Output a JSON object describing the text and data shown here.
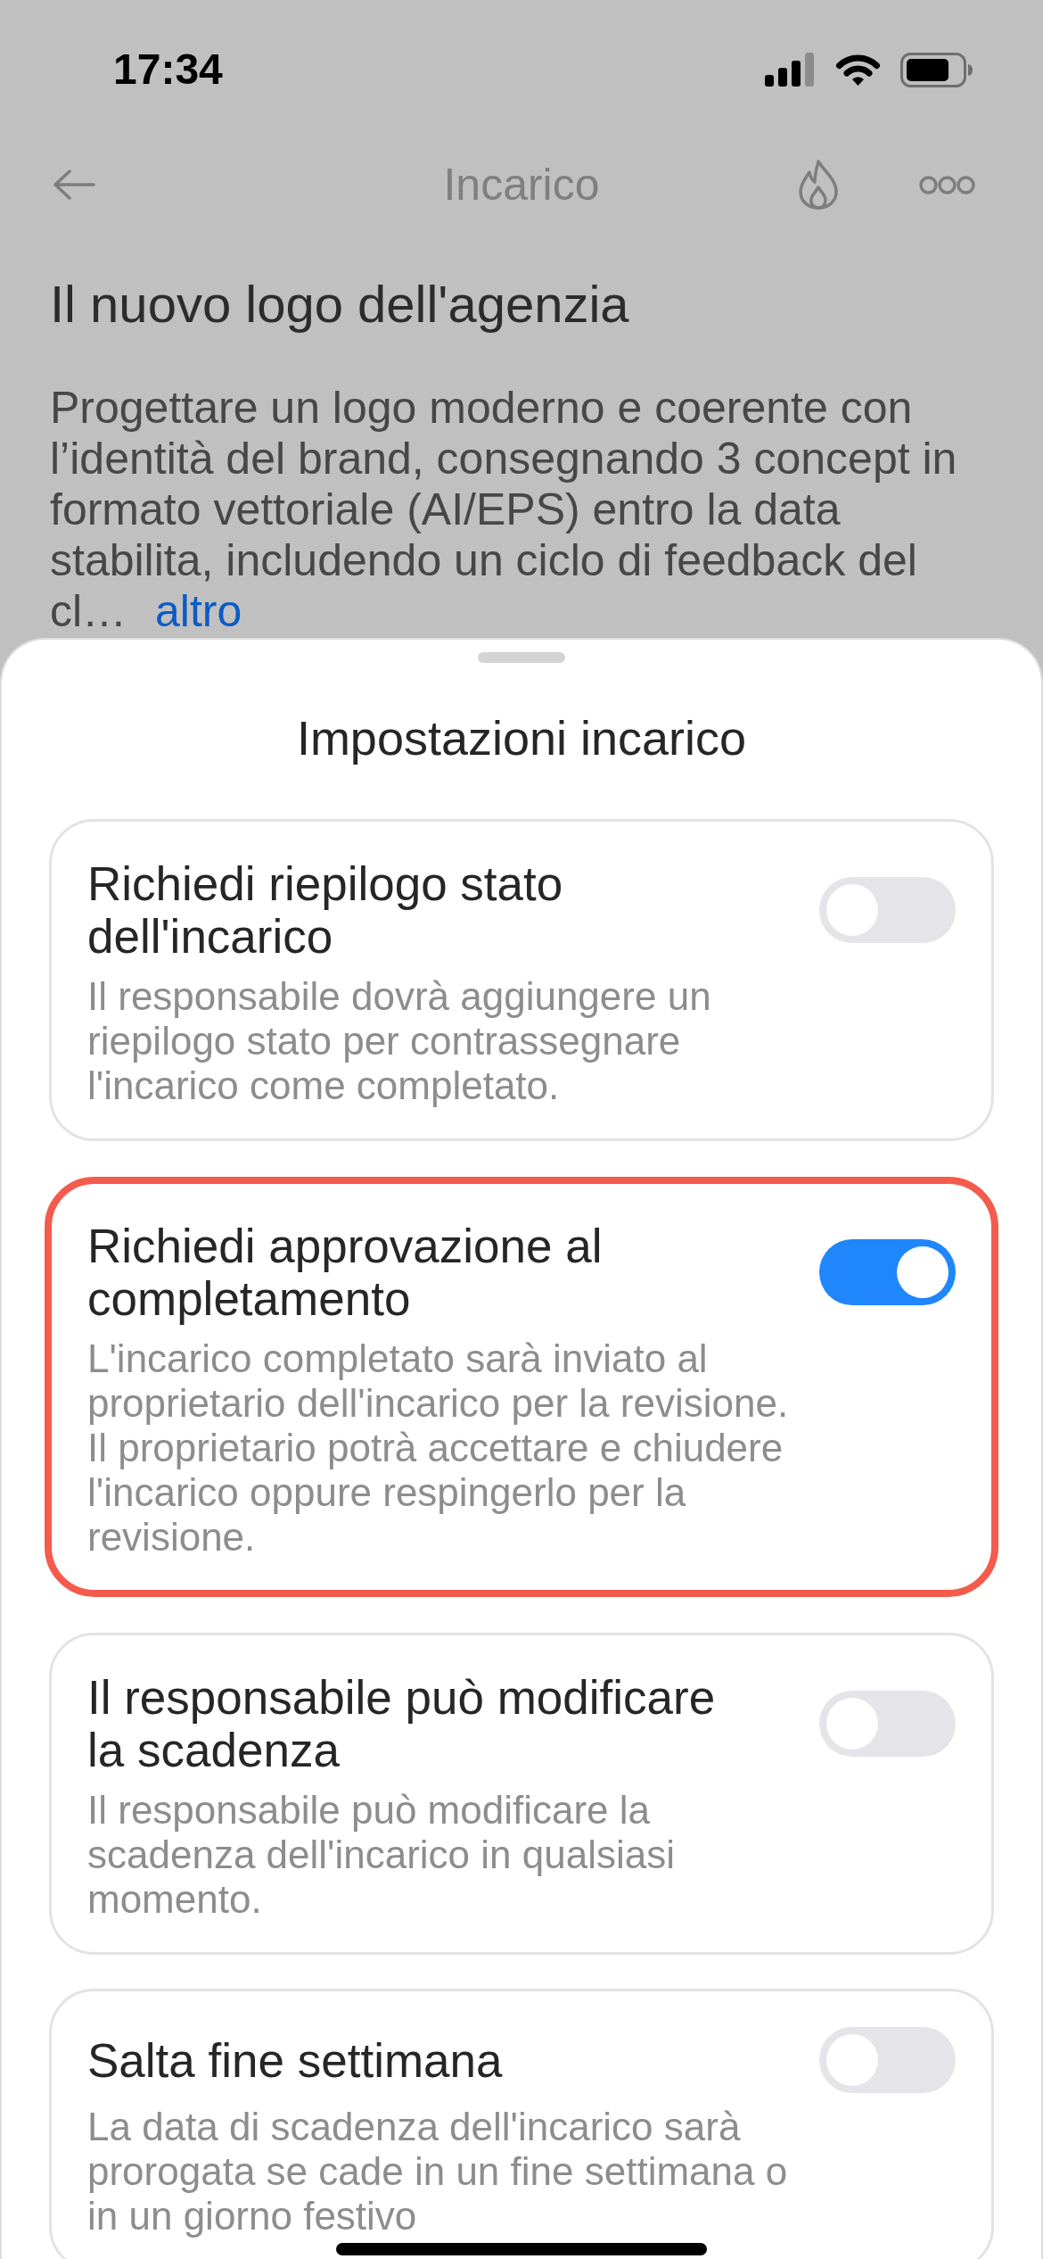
{
  "status_bar": {
    "time": "17:34"
  },
  "nav_bar": {
    "title": "Incarico"
  },
  "task": {
    "title": "Il nuovo logo dell'agenzia",
    "description": "Progettare un logo moderno e coerente con l’identità del brand, consegnando 3 concept in formato vettoriale (AI/EPS) entro la data stabilita, includendo un ciclo di feedback del cl…",
    "more_link": "altro"
  },
  "sheet": {
    "title": "Impostazioni incarico",
    "settings": [
      {
        "title": "Richiedi riepilogo stato dell'incarico",
        "description": "Il responsabile dovrà aggiungere un riepilogo stato per contrassegnare l'incarico come completato.",
        "on": false,
        "highlighted": false
      },
      {
        "title": "Richiedi approvazione al completamento",
        "description": "L'incarico completato sarà inviato al proprietario dell'incarico per la revisione. Il proprietario potrà accettare e chiudere l'incarico oppure respingerlo per la revisione.",
        "on": true,
        "highlighted": true
      },
      {
        "title": "Il responsabile può modificare la scadenza",
        "description": "Il responsabile può modificare la scadenza dell'incarico in qualsiasi momento.",
        "on": false,
        "highlighted": false
      },
      {
        "title": "Salta fine settimana",
        "description": "La data di scadenza dell'incarico sarà prorogata se cade in un fine settimana o in un giorno festivo",
        "on": false,
        "highlighted": false
      }
    ]
  }
}
